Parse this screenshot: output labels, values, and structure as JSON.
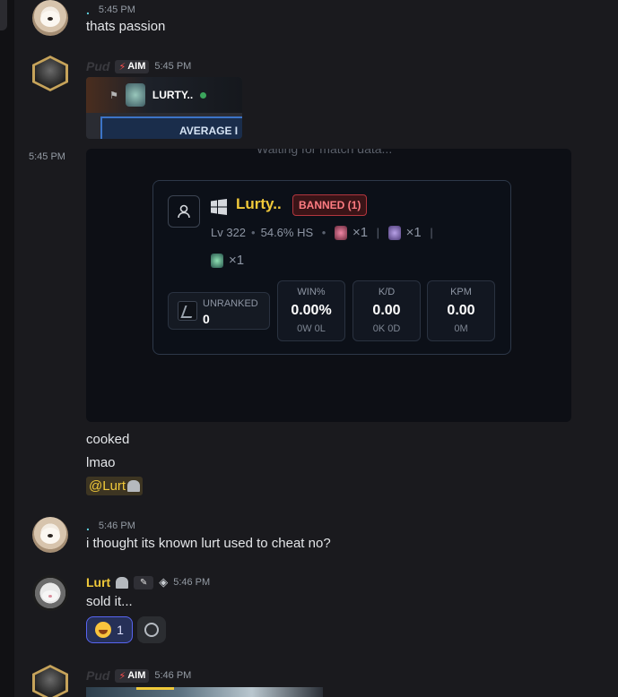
{
  "messages": {
    "m1": {
      "time": "5:45 PM",
      "text": "thats passion"
    },
    "m2": {
      "author": "Pud",
      "tag": "AIM",
      "time": "5:45 PM",
      "embed": {
        "player": "LURTY..",
        "footer": "AVERAGE I"
      }
    },
    "m3": {
      "side_time": "5:45 PM",
      "card": {
        "waiting": "Waiting for match data...",
        "player_name": "Lurty..",
        "banned": "BANNED (1)",
        "level": "Lv 322",
        "hs": "54.6% HS",
        "op_counts": [
          "×1",
          "×1",
          "×1"
        ],
        "rank": {
          "label": "UNRANKED",
          "value": "0"
        },
        "stats": [
          {
            "label": "WIN%",
            "value": "0.00%",
            "sub": "0W 0L"
          },
          {
            "label": "K/D",
            "value": "0.00",
            "sub": "0K 0D"
          },
          {
            "label": "KPM",
            "value": "0.00",
            "sub": "0M"
          }
        ]
      }
    },
    "m4": {
      "lines": [
        "cooked",
        "lmao"
      ],
      "mention": "@Lurt"
    },
    "m5": {
      "time": "5:46 PM",
      "text": "i thought its known lurt used to cheat no?"
    },
    "m6": {
      "author": "Lurt",
      "time": "5:46 PM",
      "text": "sold it...",
      "reaction_count": "1"
    },
    "m7": {
      "author": "Pud",
      "tag": "AIM",
      "time": "5:46 PM"
    }
  },
  "icons": [
    "windows-icon",
    "profile-icon",
    "flag-icon",
    "bolt-icon",
    "tombstone-icon",
    "smile-icon"
  ],
  "colors": {
    "accent_gold": "#f0c93a",
    "banned_red": "#ff7c82",
    "online_green": "#3ba55c",
    "mention_blue": "#5865f2"
  }
}
